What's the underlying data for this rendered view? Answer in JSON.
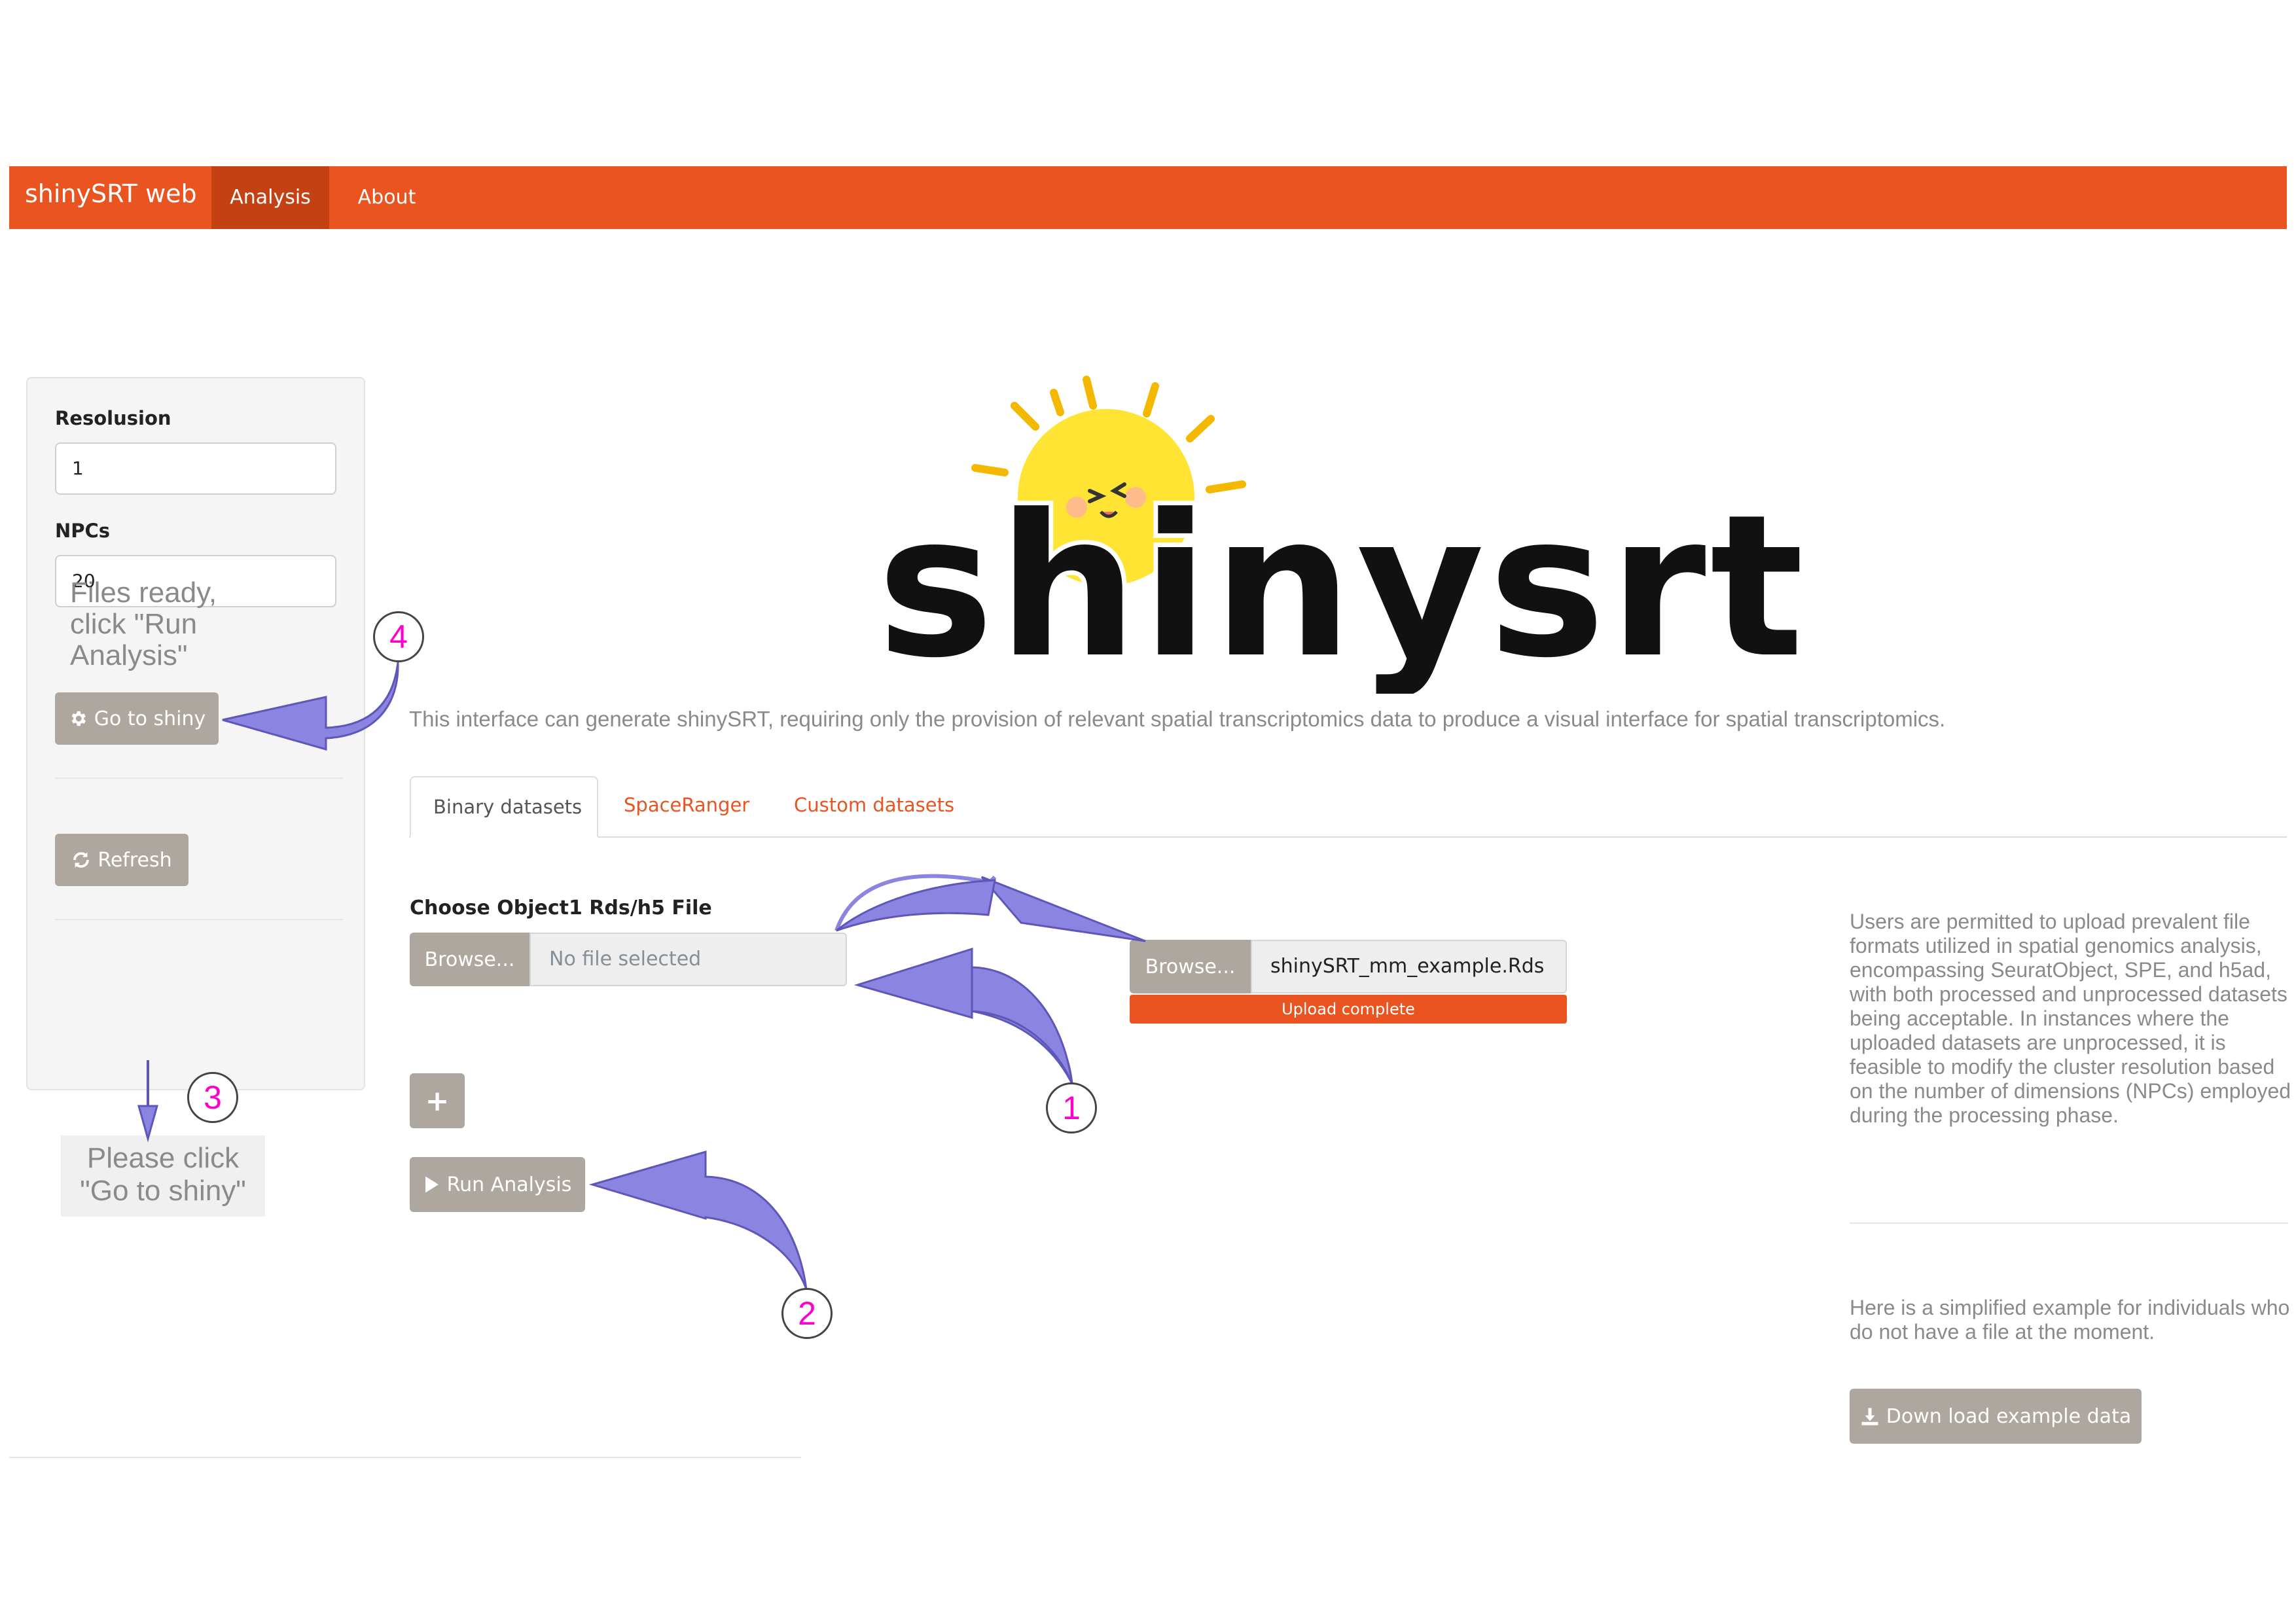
{
  "navbar": {
    "brand": "shinySRT web",
    "items": [
      {
        "label": "Analysis",
        "active": true
      },
      {
        "label": "About",
        "active": false
      }
    ],
    "color": "#e95420",
    "active_color": "#c34113"
  },
  "sidebar": {
    "resolution_label": "Resolusion",
    "resolution_value": "1",
    "npcs_label": "NPCs",
    "npcs_value": "20",
    "go_shiny_label": "Go to shiny",
    "refresh_label": "Refresh",
    "files_ready_note": "Files ready, click \"Run Analysis\""
  },
  "please_click_note": "Please click \"Go to shiny\"",
  "logo": {
    "text": "shinysrt"
  },
  "main": {
    "description": "This interface can generate shinySRT, requiring only the provision of relevant spatial transcriptomics data to produce a visual interface for spatial transcriptomics.",
    "tabs": [
      {
        "label": "Binary datasets",
        "active": true
      },
      {
        "label": "SpaceRanger",
        "active": false
      },
      {
        "label": "Custom datasets",
        "active": false
      }
    ],
    "file_label": "Choose Object1 Rds/h5 File",
    "browse_label": "Browse...",
    "file_placeholder": "No file selected",
    "uploaded": {
      "browse_label": "Browse...",
      "file_name": "shinySRT_mm_example.Rds",
      "progress_text": "Upload complete",
      "progress": 1.0
    },
    "add_label": "+",
    "run_label": "Run Analysis"
  },
  "right_panel": {
    "note": "Users are permitted to upload prevalent file formats utilized in spatial genomics analysis, encompassing SeuratObject, SPE, and h5ad, with both processed and unprocessed datasets being acceptable. In instances where the uploaded datasets are unprocessed, it is feasible to modify the cluster resolution based on the number of dimensions (NPCs) employed during the processing phase.",
    "example_note": "Here is a simplified example for individuals who do not have a file at the moment.",
    "download_label": "Down load example data"
  },
  "annotations": {
    "steps": [
      "1",
      "2",
      "3",
      "4"
    ],
    "number_color": "#ff00cc",
    "arrow_color": "#8b84e0"
  },
  "icons": {
    "go_shiny": "gear-icon",
    "refresh": "refresh-icon",
    "run": "play-icon",
    "download": "download-icon"
  },
  "colors": {
    "button_gray": "#aea79f",
    "accent": "#e95420",
    "muted_text": "#8a8a8a"
  }
}
